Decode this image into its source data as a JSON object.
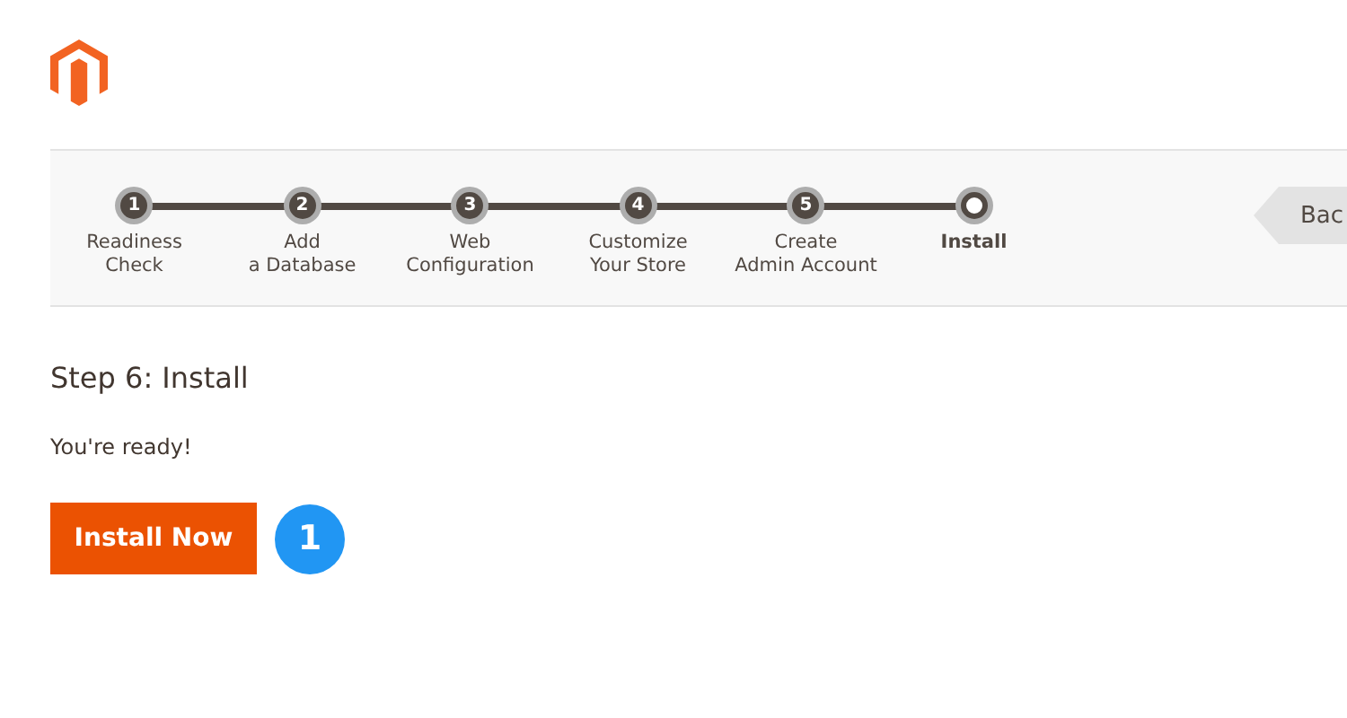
{
  "steps": [
    {
      "number": "1",
      "label": "Readiness\nCheck",
      "current": false
    },
    {
      "number": "2",
      "label": "Add\na Database",
      "current": false
    },
    {
      "number": "3",
      "label": "Web\nConfiguration",
      "current": false
    },
    {
      "number": "4",
      "label": "Customize\nYour Store",
      "current": false
    },
    {
      "number": "5",
      "label": "Create\nAdmin Account",
      "current": false
    },
    {
      "label": "Install",
      "current": true
    }
  ],
  "back_button": {
    "label": "Bac"
  },
  "heading": "Step 6: Install",
  "message": "You're ready!",
  "install_button": {
    "label": "Install Now"
  },
  "callout": "1"
}
